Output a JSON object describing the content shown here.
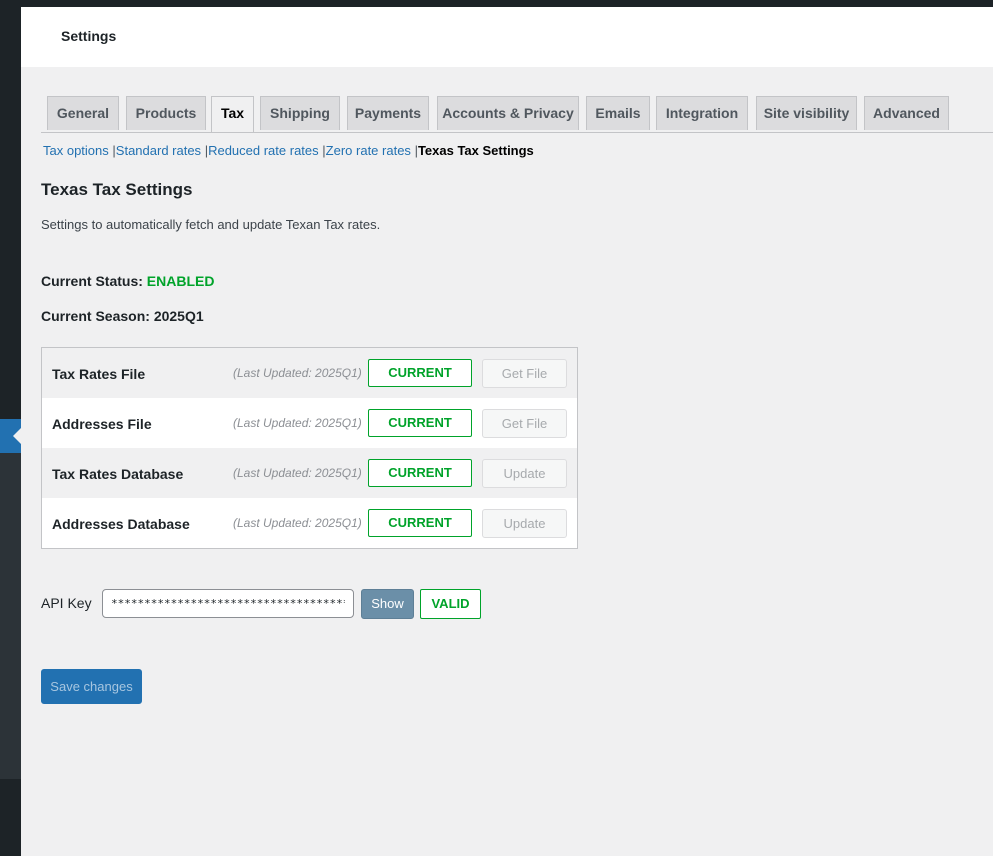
{
  "header": {
    "title": "Settings"
  },
  "tabs": [
    {
      "label": "General"
    },
    {
      "label": "Products"
    },
    {
      "label": "Tax",
      "active": true
    },
    {
      "label": "Shipping"
    },
    {
      "label": "Payments"
    },
    {
      "label": "Accounts & Privacy"
    },
    {
      "label": "Emails"
    },
    {
      "label": "Integration"
    },
    {
      "label": "Site visibility"
    },
    {
      "label": "Advanced"
    }
  ],
  "subnav": {
    "items": [
      "Tax options",
      "Standard rates",
      "Reduced rate rates",
      "Zero rate rates"
    ],
    "separator": "|",
    "current": "Texas Tax Settings"
  },
  "page": {
    "heading": "Texas Tax Settings",
    "description": "Settings to automatically fetch and update Texan Tax rates.",
    "status_label": "Current Status:",
    "status_value": "ENABLED",
    "season_label": "Current Season:",
    "season_value": "2025Q1"
  },
  "files": [
    {
      "name": "Tax Rates File",
      "updated": "(Last Updated: 2025Q1)",
      "status": "CURRENT",
      "action": "Get File"
    },
    {
      "name": "Addresses File",
      "updated": "(Last Updated: 2025Q1)",
      "status": "CURRENT",
      "action": "Get File"
    },
    {
      "name": "Tax Rates Database",
      "updated": "(Last Updated: 2025Q1)",
      "status": "CURRENT",
      "action": "Update"
    },
    {
      "name": "Addresses Database",
      "updated": "(Last Updated: 2025Q1)",
      "status": "CURRENT",
      "action": "Update"
    }
  ],
  "api": {
    "label": "API Key",
    "value": "****************************************",
    "show_label": "Show",
    "validity": "VALID"
  },
  "save_label": "Save changes",
  "colors": {
    "accent": "#2271b1",
    "success": "#00a32a",
    "admin_sidebar": "#1d2327",
    "background": "#f0f0f1"
  }
}
